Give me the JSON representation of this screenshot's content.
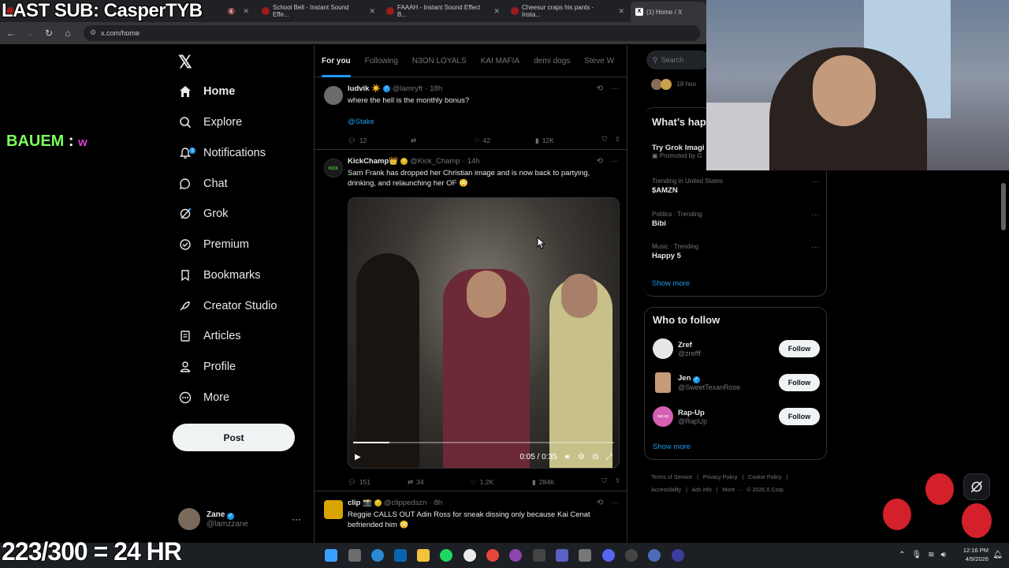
{
  "browser": {
    "tabs": [
      {
        "label": "LAST SUB: CasperTYB",
        "active": false
      },
      {
        "label": "School Bell - Instant Sound Effe...",
        "active": false
      },
      {
        "label": "FAAAH - Instant Sound Effect B...",
        "active": false
      },
      {
        "label": "Cheesur craps his pants - Insta...",
        "active": false
      },
      {
        "label": "(1) Home / X",
        "active": true
      }
    ],
    "url": "x.com/home"
  },
  "overlay": {
    "last_sub": "LAST SUB: CasperTYB",
    "chat_user": "BAUEM",
    "chat_sep": ":",
    "chat_msg": "w",
    "counter": "223/300 = 24 HR"
  },
  "nav": {
    "items": [
      {
        "label": "Home",
        "icon": "home-icon"
      },
      {
        "label": "Explore",
        "icon": "search-icon"
      },
      {
        "label": "Notifications",
        "icon": "bell-icon",
        "badge": "1"
      },
      {
        "label": "Chat",
        "icon": "chat-icon"
      },
      {
        "label": "Grok",
        "icon": "grok-icon"
      },
      {
        "label": "Premium",
        "icon": "premium-icon"
      },
      {
        "label": "Bookmarks",
        "icon": "bookmark-icon"
      },
      {
        "label": "Creator Studio",
        "icon": "rocket-icon"
      },
      {
        "label": "Articles",
        "icon": "articles-icon"
      },
      {
        "label": "Profile",
        "icon": "profile-icon"
      },
      {
        "label": "More",
        "icon": "more-icon"
      }
    ],
    "post_label": "Post",
    "account": {
      "name": "Zane",
      "handle": "@lamzzane"
    }
  },
  "feed": {
    "tabs": [
      "For you",
      "Following",
      "N3ON LOYALS",
      "KAI MAFIA",
      "demi dogs",
      "Steve W"
    ],
    "tweets": [
      {
        "name": "ludvik ☀️",
        "handle": "@lamryft",
        "time": "18h",
        "text": "where the hell is the monthly bonus?",
        "link": "@Stake",
        "replies": "12",
        "reposts": "",
        "likes": "42",
        "views": "12K"
      },
      {
        "name": "KickChamp👑",
        "handle": "@Kick_Champ",
        "time": "14h",
        "text": "Sam Frank has dropped her Christian image and is now back to partying, drinking, and relaunching her OF 😳",
        "video_time": "0:05 / 0:35",
        "video_progress": 0.14,
        "replies": "151",
        "reposts": "34",
        "likes": "1.2K",
        "views": "284K"
      },
      {
        "name": "clip 📸",
        "handle": "@clippedszn",
        "time": "8h",
        "text": "Reggie CALLS OUT Adin Ross for sneak dissing only because Kai Cenat befriended him 😳"
      }
    ]
  },
  "right": {
    "search_placeholder": "Search",
    "partial_top": "18 hou",
    "whats_happening": "What’s hap",
    "promo": {
      "title": "Try Grok Imagi",
      "sub": "Promoted by G"
    },
    "trends": [
      {
        "category": "Trending in United States",
        "name": "$AMZN"
      },
      {
        "category": "Politics · Trending",
        "name": "Bibi"
      },
      {
        "category": "Music · Trending",
        "name": "Happy 5"
      }
    ],
    "show_more": "Show more",
    "who_to_follow": "Who to follow",
    "follow": [
      {
        "name": "Zref",
        "handle": "@zrefff",
        "verified": false
      },
      {
        "name": "Jen",
        "handle": "@SweetTexanRose",
        "verified": true
      },
      {
        "name": "Rap-Up",
        "handle": "@RapUp",
        "verified": false
      }
    ],
    "follow_label": "Follow",
    "footer": [
      "Terms of Service",
      "|",
      "Privacy Policy",
      "|",
      "Cookie Policy",
      "|",
      "Accessibility",
      "|",
      "Ads info",
      "|",
      "More ···",
      "© 2026 X Corp."
    ]
  },
  "taskbar": {
    "time": "12:16 PM",
    "date": "4/9/2026"
  }
}
